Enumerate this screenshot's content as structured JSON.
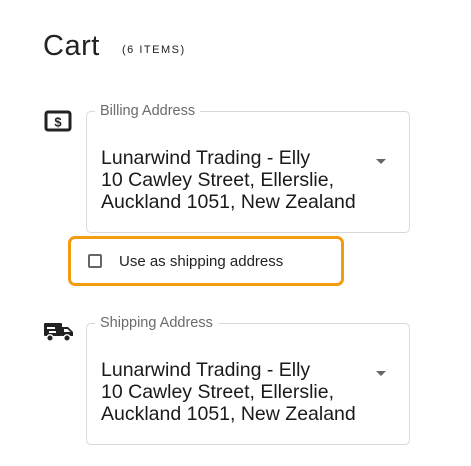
{
  "cart": {
    "title": "Cart",
    "count_label": "(6 ITEMS)"
  },
  "billing": {
    "legend": "Billing Address",
    "lines": [
      "Lunarwind Trading - Elly",
      "10 Cawley Street, Ellerslie,",
      "Auckland 1051, New Zealand"
    ],
    "icon": "dollar-bill-icon"
  },
  "use_as_shipping": {
    "label": "Use as shipping address",
    "checked": false,
    "highlight_color": "#f39c12"
  },
  "shipping": {
    "legend": "Shipping Address",
    "lines": [
      "Lunarwind Trading - Elly",
      "10 Cawley Street, Ellerslie,",
      "Auckland 1051, New Zealand"
    ],
    "icon": "delivery-truck-icon"
  }
}
